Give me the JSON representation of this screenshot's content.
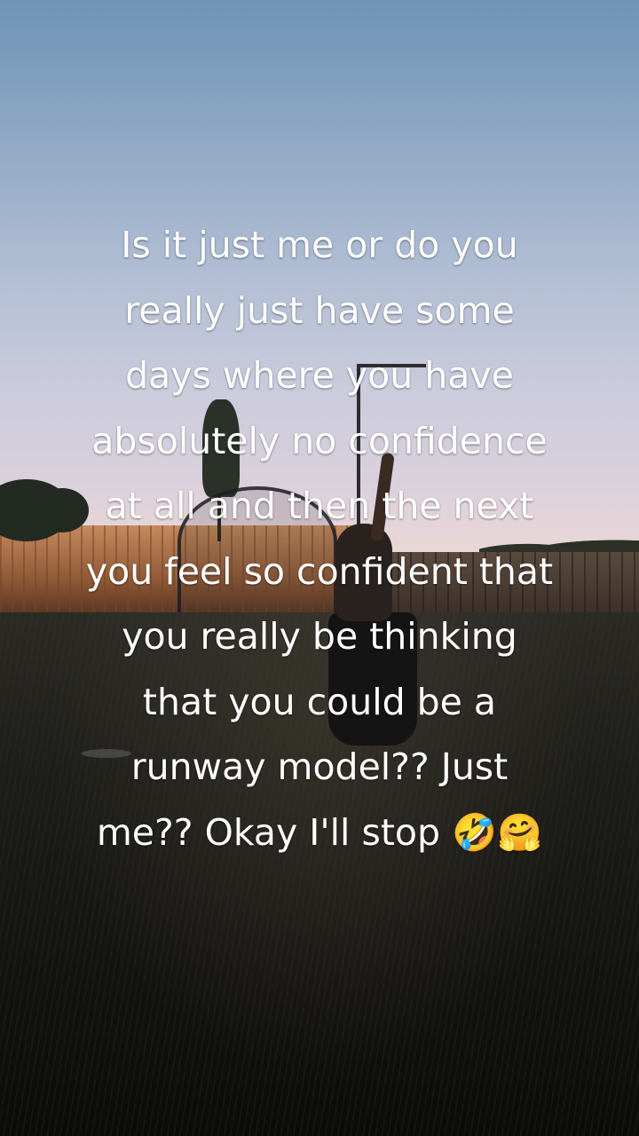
{
  "post": {
    "caption_lines": [
      "Is it just me or do you",
      "really just have some",
      "days where you have",
      "absolutely no confidence",
      "at all and then the next",
      "you feel so confident that",
      "you really be thinking",
      "that you could be a",
      "runway model?? Just",
      "me?? Okay I'll stop 🤣🤗"
    ],
    "text_color": "#ffffff"
  },
  "scene": {
    "sky_top_color": "#6f93b6",
    "horizon_color": "#ead8d2",
    "ground_color": "#121210"
  }
}
